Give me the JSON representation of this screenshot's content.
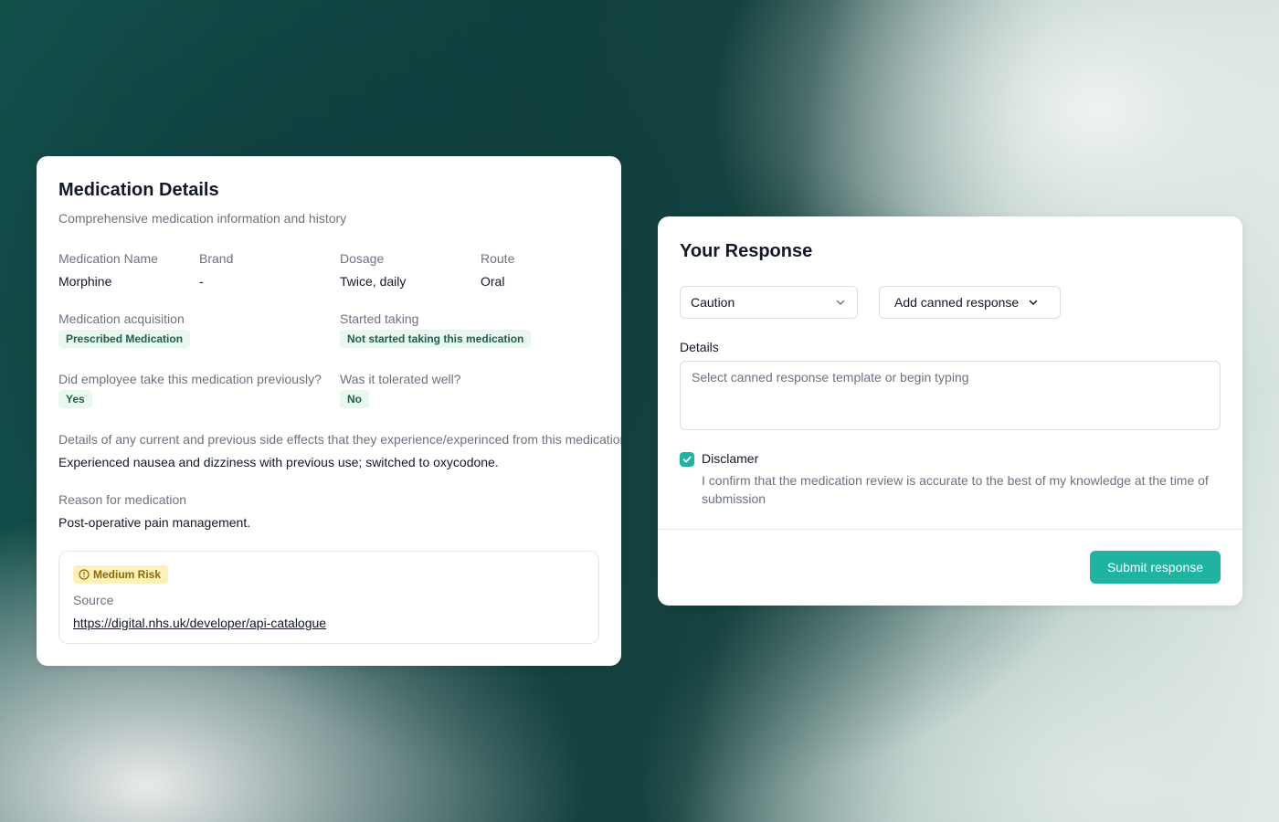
{
  "medication_card": {
    "title": "Medication Details",
    "subtitle": "Comprehensive medication information and history",
    "fields": {
      "name_label": "Medication Name",
      "name_value": "Morphine",
      "brand_label": "Brand",
      "brand_value": "-",
      "dosage_label": "Dosage",
      "dosage_value": "Twice, daily",
      "route_label": "Route",
      "route_value": "Oral",
      "acquisition_label": "Medication acquisition",
      "acquisition_value": "Prescribed Medication",
      "started_label": "Started taking",
      "started_value": "Not started taking this medication",
      "previous_label": "Did employee take this medication previously?",
      "previous_value": "Yes",
      "tolerated_label": "Was it tolerated well?",
      "tolerated_value": "No",
      "side_effects_label": "Details of any current and previous side effects that they experience/experinced from this medication",
      "side_effects_value": "Experienced nausea and dizziness with previous use; switched to oxycodone.",
      "reason_label": "Reason for medication",
      "reason_value": "Post-operative pain management."
    },
    "risk": {
      "badge": "Medium Risk",
      "badge_icon": "info-circle-icon",
      "source_label": "Source",
      "source_url": "https://digital.nhs.uk/developer/api-catalogue"
    }
  },
  "response_card": {
    "title": "Your Response",
    "status_select": {
      "value": "Caution",
      "icon": "chevron-down-icon"
    },
    "canned_button": {
      "label": "Add canned response",
      "icon": "chevron-down-icon"
    },
    "details_label": "Details",
    "details_placeholder": "Select canned response template or begin typing",
    "disclaimer": {
      "checked": true,
      "label": "Disclamer",
      "text": "I confirm that the medication review is accurate to the best of my knowledge at the time of submission"
    },
    "submit_label": "Submit response"
  },
  "colors": {
    "accent": "#1fb3a2",
    "tag_bg": "#e9f7ef",
    "tag_text": "#1f5f4c",
    "risk_bg": "#fdf0b8",
    "risk_text": "#8a6a00"
  }
}
